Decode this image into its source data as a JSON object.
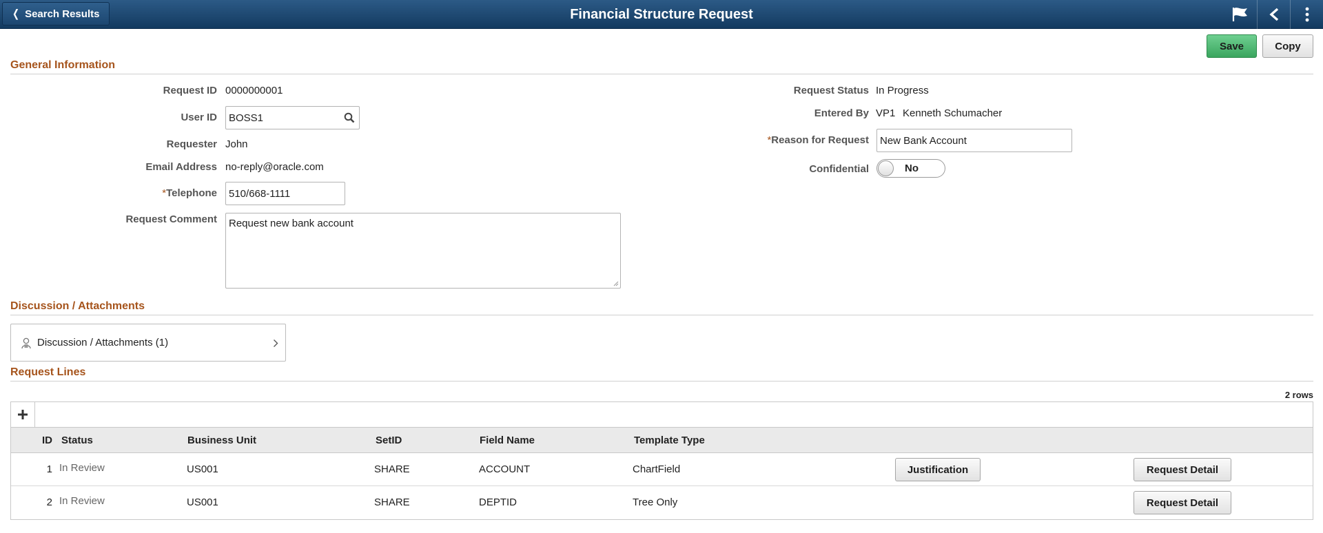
{
  "header": {
    "back_label": "Search Results",
    "title": "Financial Structure Request",
    "icons": [
      "flag-icon",
      "back-arrow-icon",
      "more-actions-icon"
    ]
  },
  "toolbar": {
    "save_label": "Save",
    "copy_label": "Copy"
  },
  "general": {
    "section_title": "General Information",
    "request_id": {
      "label": "Request ID",
      "value": "0000000001"
    },
    "user_id": {
      "label": "User ID",
      "value": "BOSS1"
    },
    "requester": {
      "label": "Requester",
      "value": "John"
    },
    "email": {
      "label": "Email Address",
      "value": "no-reply@oracle.com"
    },
    "telephone": {
      "label": "Telephone",
      "required": "*",
      "value": "510/668-1111"
    },
    "comment": {
      "label": "Request Comment",
      "value": "Request new bank account"
    },
    "status": {
      "label": "Request Status",
      "value": "In Progress"
    },
    "entered_by": {
      "label": "Entered By",
      "id": "VP1",
      "name": "Kenneth Schumacher"
    },
    "reason": {
      "label": "Reason for Request",
      "required": "*",
      "value": "New Bank Account"
    },
    "confidential": {
      "label": "Confidential",
      "value": "No"
    }
  },
  "discussion": {
    "section_title": "Discussion / Attachments",
    "link_label": "Discussion / Attachments (1)"
  },
  "lines": {
    "section_title": "Request Lines",
    "row_count": "2 rows",
    "columns": [
      "ID",
      "Status",
      "Business Unit",
      "SetID",
      "Field Name",
      "Template Type"
    ],
    "rows": [
      {
        "id": "1",
        "status": "In Review",
        "business_unit": "US001",
        "setid": "SHARE",
        "field_name": "ACCOUNT",
        "template_type": "ChartField",
        "justification": "Justification",
        "detail": "Request Detail"
      },
      {
        "id": "2",
        "status": "In Review",
        "business_unit": "US001",
        "setid": "SHARE",
        "field_name": "DEPTID",
        "template_type": "Tree Only",
        "detail": "Request Detail"
      }
    ]
  },
  "colors": {
    "banner": "#1f4a74",
    "section_title": "#a6541c",
    "save_button": "#4cba72"
  }
}
